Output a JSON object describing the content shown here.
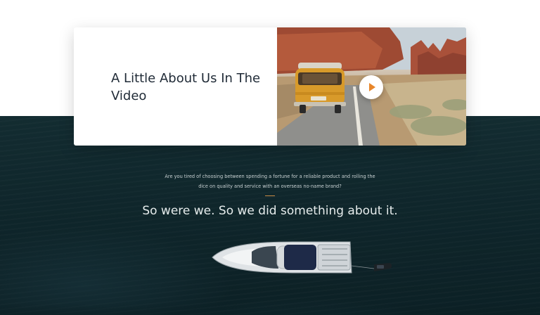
{
  "about_card": {
    "title": "A Little About Us In The Video",
    "play_icon": "play-icon"
  },
  "intro": {
    "text": "Are you tired of choosing between spending a fortune for a reliable product and rolling the dice on quality and service with an overseas no-name brand?"
  },
  "tagline": "So were we.  So we did something about it.",
  "colors": {
    "accent": "#e8862a",
    "divider": "#c98b45",
    "ocean": "#0f262b",
    "title": "#1f2a36"
  }
}
